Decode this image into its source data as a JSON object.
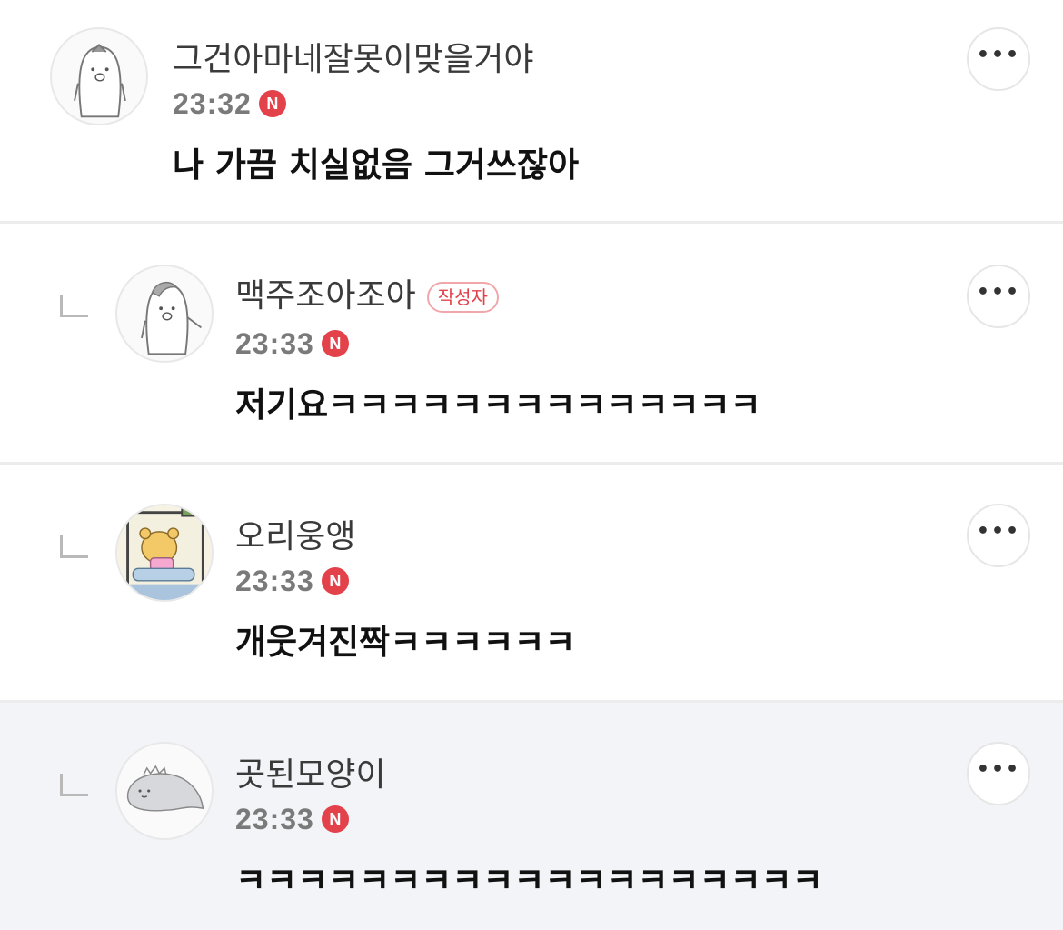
{
  "comments": [
    {
      "username": "그건아마네잘못이맞을거야",
      "time": "23:32",
      "badge": "N",
      "text": "나 가끔 치실없음 그거쓰잖아",
      "more_label": "•••"
    },
    {
      "username": "맥주조아조아",
      "author_badge": "작성자",
      "time": "23:33",
      "badge": "N",
      "text": "저기요ㅋㅋㅋㅋㅋㅋㅋㅋㅋㅋㅋㅋㅋㅋ",
      "more_label": "•••"
    },
    {
      "username": "오리웅앵",
      "time": "23:33",
      "badge": "N",
      "text": "개웃겨진짝ㅋㅋㅋㅋㅋㅋ",
      "more_label": "•••"
    },
    {
      "username": "곳된모양이",
      "time": "23:33",
      "badge": "N",
      "text": "ㅋㅋㅋㅋㅋㅋㅋㅋㅋㅋㅋㅋㅋㅋㅋㅋㅋㅋㅋ",
      "more_label": "•••"
    }
  ],
  "colors": {
    "highlight_bg": "#f2f4f8",
    "badge_red": "#e3424b"
  }
}
